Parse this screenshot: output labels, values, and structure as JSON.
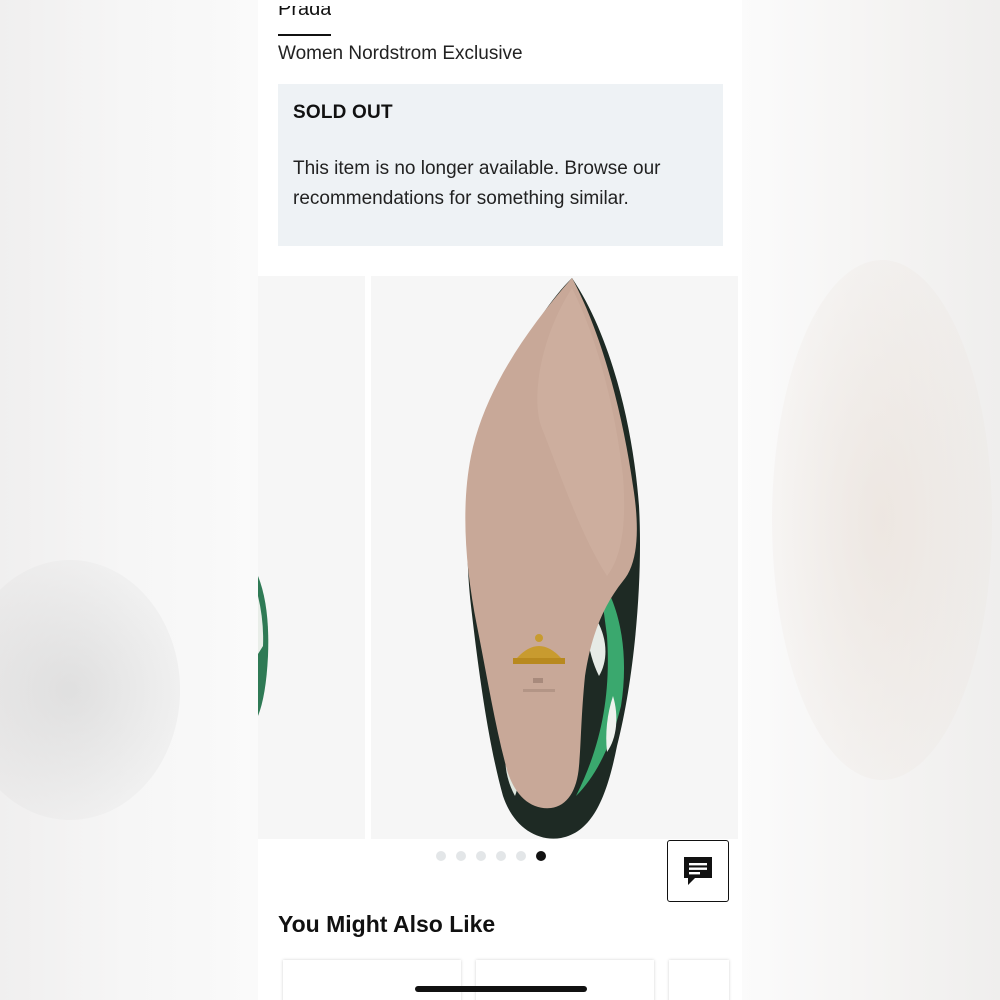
{
  "product": {
    "brand": "Prada",
    "subtitle": "Women Nordstrom Exclusive"
  },
  "availability": {
    "status": "SOLD OUT",
    "message": "This item is no longer available. Browse our recommendations for something similar."
  },
  "gallery": {
    "image_count": 6,
    "active_index": 6,
    "main_image": "shoe-sole-image",
    "colors": {
      "sole": "#c8a898",
      "print_green": "#1e8c55",
      "print_dark": "#1d2a24"
    }
  },
  "recommendations": {
    "title": "You Might Also Like"
  },
  "icons": {
    "chat": "chat-bubble-icon"
  }
}
